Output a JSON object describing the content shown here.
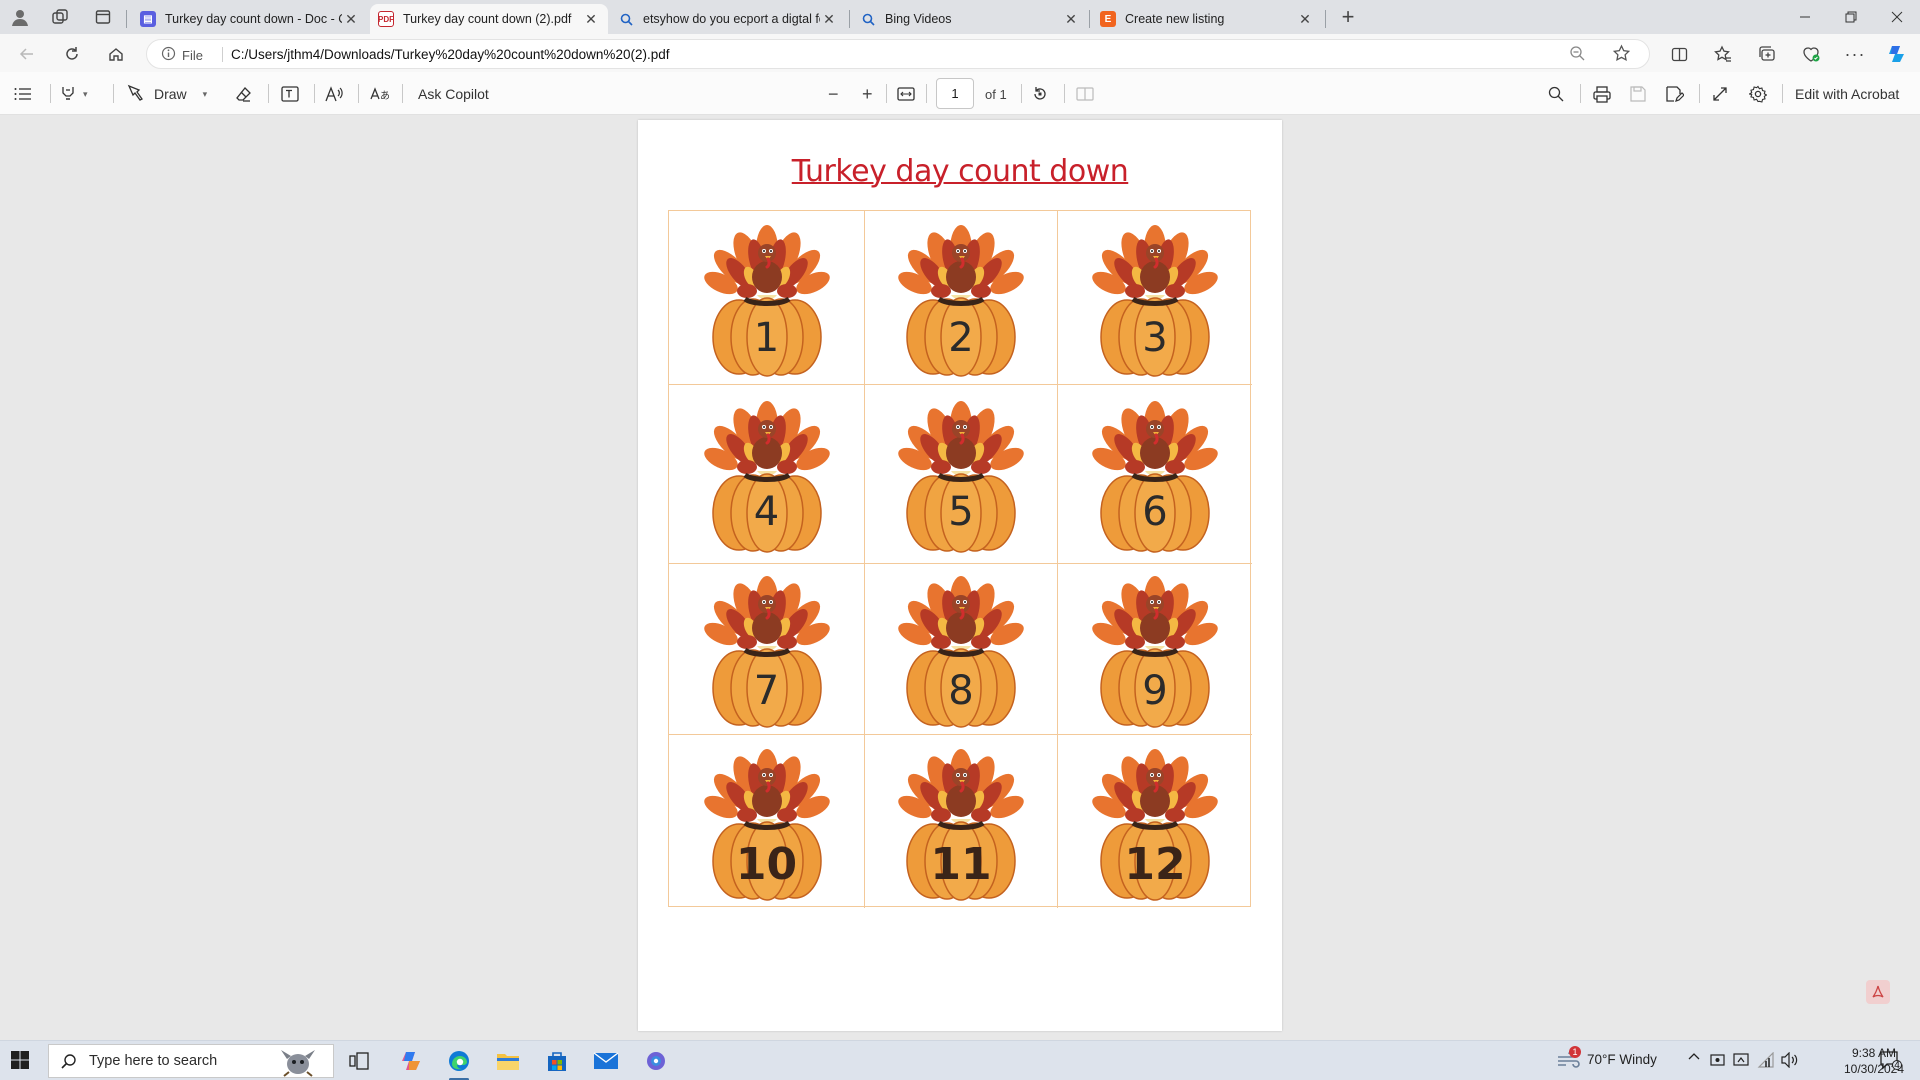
{
  "browser": {
    "tabs": [
      {
        "title": "Turkey day count down - Doc - Ca",
        "active": false,
        "favicon": "canva-doc-icon"
      },
      {
        "title": "Turkey day count down (2).pdf",
        "active": true,
        "favicon": "pdf-icon"
      },
      {
        "title": "etsyhow do you ecport a digtal fo",
        "active": false,
        "favicon": "search-icon"
      },
      {
        "title": "Bing Videos",
        "active": false,
        "favicon": "search-icon"
      },
      {
        "title": "Create new listing",
        "active": false,
        "favicon": "etsy-icon"
      }
    ],
    "address": {
      "scheme_label": "File",
      "url": "C:/Users/jthm4/Downloads/Turkey%20day%20count%20down%20(2).pdf"
    }
  },
  "pdf_toolbar": {
    "draw_label": "Draw",
    "ask_copilot_label": "Ask Copilot",
    "page_current": "1",
    "page_total": "of 1",
    "edit_acrobat_label": "Edit with Acrobat"
  },
  "document": {
    "title": "Turkey day count down",
    "numbers": [
      "1",
      "2",
      "3",
      "4",
      "5",
      "6",
      "7",
      "8",
      "9",
      "10",
      "11",
      "12"
    ]
  },
  "taskbar": {
    "search_placeholder": "Type here to search",
    "weather": "70°F  Windy",
    "weather_badge": "1",
    "time": "9:38 AM",
    "date": "10/30/2024",
    "notification_count": "4"
  },
  "colors": {
    "title_red": "#c8202a",
    "pumpkin_orange": "#ee9b3a",
    "feather_dark": "#b63a26",
    "feather_light": "#e8742f",
    "grid_border": "#f3c999",
    "edge_accent": "#0f6cbd"
  }
}
